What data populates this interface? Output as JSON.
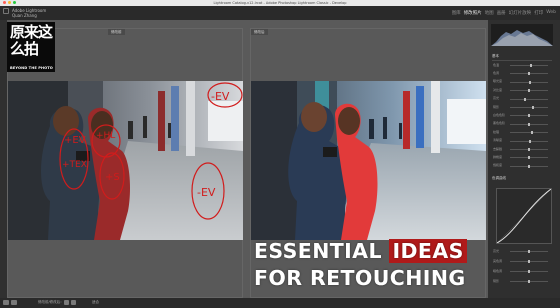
{
  "window": {
    "title": "Lightroom Catalog-v12.lrcat - Adobe Photoshop Lightroom Classic - Develop",
    "controls": [
      "#ff5f57",
      "#febc2e",
      "#28c840"
    ]
  },
  "identity": {
    "line1": "Adobe Lightroom",
    "line2": "Quan Zhang"
  },
  "modules": [
    {
      "label": "图库",
      "active": false
    },
    {
      "label": "修改照片",
      "active": true
    },
    {
      "label": "地图",
      "active": false
    },
    {
      "label": "画册",
      "active": false
    },
    {
      "label": "幻灯片放映",
      "active": false
    },
    {
      "label": "打印",
      "active": false
    },
    {
      "label": "Web",
      "active": false
    }
  ],
  "compare": {
    "before_label": "修改前",
    "after_label": "修改后"
  },
  "annotations": [
    "+EV",
    "+HL",
    "+TEX",
    "+S",
    "-EV",
    "-EV"
  ],
  "bottom_toolbar": {
    "view_label": "修改前/修改后：",
    "zoom_label": "适合"
  },
  "right_panel": {
    "basic_header": "基本",
    "sliders": [
      {
        "label": "色温",
        "value": 0.55
      },
      {
        "label": "色调",
        "value": 0.5
      },
      {
        "label": "曝光度",
        "value": 0.52
      },
      {
        "label": "对比度",
        "value": 0.5
      },
      {
        "label": "高光",
        "value": 0.4
      },
      {
        "label": "阴影",
        "value": 0.6
      },
      {
        "label": "白色色阶",
        "value": 0.5
      },
      {
        "label": "黑色色阶",
        "value": 0.5
      },
      {
        "label": "纹理",
        "value": 0.58
      },
      {
        "label": "清晰度",
        "value": 0.52
      },
      {
        "label": "去朦胧",
        "value": 0.5
      },
      {
        "label": "鲜艳度",
        "value": 0.5
      },
      {
        "label": "饱和度",
        "value": 0.5
      }
    ],
    "curve_header": "色调曲线",
    "curve_sliders": [
      {
        "label": "高光",
        "value": 0.5
      },
      {
        "label": "亮色调",
        "value": 0.5
      },
      {
        "label": "暗色调",
        "value": 0.5
      },
      {
        "label": "阴影",
        "value": 0.5
      }
    ]
  },
  "logo": {
    "chinese": "原来这么拍",
    "english": "BEYOND THE PHOTO"
  },
  "headline": {
    "line1_a": "ESSENTIAL",
    "line1_b": "IDEAS",
    "line2": "FOR RETOUCHING"
  },
  "colors": {
    "accent": "#b01a1a",
    "annotation": "#d11c1c"
  }
}
